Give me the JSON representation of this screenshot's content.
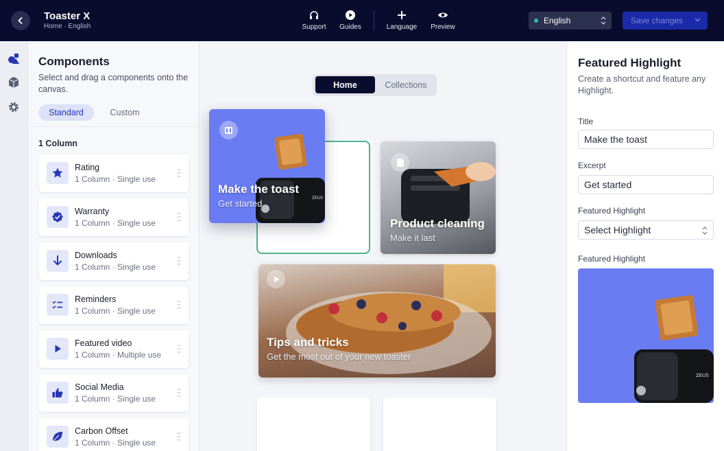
{
  "topbar": {
    "title": "Toaster X",
    "breadcrumb": "Home · English",
    "tools": [
      {
        "label": "Support",
        "icon": "headphones-icon"
      },
      {
        "label": "Guides",
        "icon": "play-circle-icon"
      },
      {
        "label": "Language",
        "icon": "plus-icon"
      },
      {
        "label": "Preview",
        "icon": "eye-icon"
      }
    ],
    "language": "English",
    "save_label": "Save changes"
  },
  "rail": {
    "icons": [
      "shapes-icon",
      "box-icon",
      "gear-icon"
    ]
  },
  "components": {
    "title": "Components",
    "description": "Select and drag a components onto the canvas.",
    "tabs": [
      "Standard",
      "Custom"
    ],
    "section": "1 Column",
    "items": [
      {
        "name": "Rating",
        "meta": "1 Column · Single use",
        "icon": "star-icon"
      },
      {
        "name": "Warranty",
        "meta": "1 Column · Single use",
        "icon": "verified-badge-icon"
      },
      {
        "name": "Downloads",
        "meta": "1 Column · Single use",
        "icon": "arrow-down-icon"
      },
      {
        "name": "Reminders",
        "meta": "1 Column · Single use",
        "icon": "checklist-icon"
      },
      {
        "name": "Featured video",
        "meta": "1 Column · Multiple use",
        "icon": "play-icon"
      },
      {
        "name": "Social Media",
        "meta": "1 Column · Single use",
        "icon": "thumbs-up-icon"
      },
      {
        "name": "Carbon Offset",
        "meta": "1 Column · Single use",
        "icon": "leaf-icon"
      }
    ]
  },
  "canvas": {
    "tabs": [
      "Home",
      "Collections"
    ],
    "tiles": [
      {
        "title": "Make the toast",
        "subtitle": "Get started"
      },
      {
        "title": "Product cleaning",
        "subtitle": "Make it last"
      },
      {
        "title": "Tips and tricks",
        "subtitle": "Get the most out of your new toaster"
      }
    ]
  },
  "props": {
    "title": "Featured Highlight",
    "description": "Create a shortcut and feature any Highlight.",
    "title_label": "Title",
    "title_value": "Make the toast",
    "excerpt_label": "Excerpt",
    "excerpt_value": "Get started",
    "highlight_label": "Featured Highlight",
    "highlight_value": "Select Highlight",
    "preview_label": "Featured Highlight"
  },
  "colors": {
    "topbar": "#0a0c2e",
    "accent": "#2637b4",
    "highlight_bg": "#6a7cf2",
    "drop_border": "#4fb38a"
  }
}
